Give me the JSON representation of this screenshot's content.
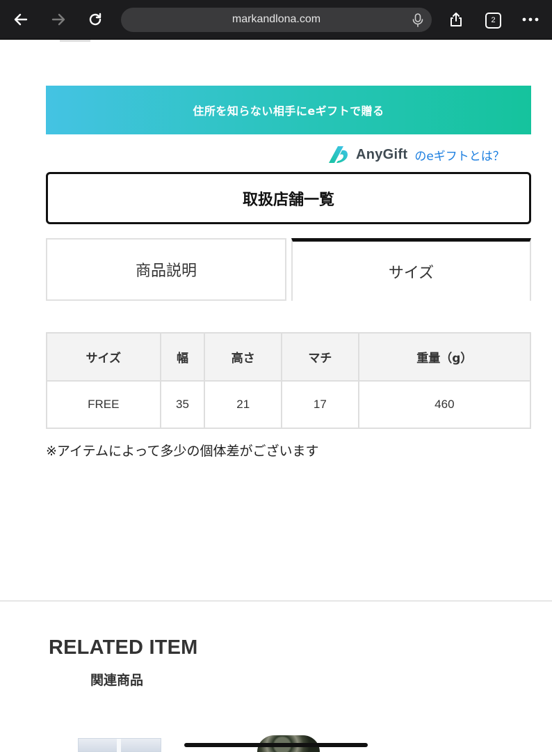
{
  "browser": {
    "url": "markandlona.com",
    "tab_count": "2",
    "icons": {
      "back": "arrow-left-icon",
      "forward": "arrow-right-icon",
      "reload": "reload-icon",
      "mic": "microphone-icon",
      "share": "share-icon",
      "tabs": "tabs-icon",
      "more": "more-dots-icon"
    }
  },
  "egift": {
    "banner_label": "住所を知らない相手にeギフトで贈る",
    "brand": "AnyGift",
    "link_label": "のeギフトとは？",
    "colors": {
      "gradient_start": "#44c3e3",
      "gradient_end": "#15c39d",
      "link": "#1d7fe0"
    }
  },
  "stores_button_label": "取扱店舗一覧",
  "tabs": [
    {
      "label": "商品説明",
      "active": false
    },
    {
      "label": "サイズ",
      "active": true
    }
  ],
  "size_table": {
    "headers": [
      "サイズ",
      "幅",
      "高さ",
      "マチ",
      "重量（g）"
    ],
    "rows": [
      [
        "FREE",
        "35",
        "21",
        "17",
        "460"
      ]
    ]
  },
  "size_note": "※アイテムによって多少の個体差がございます",
  "related": {
    "title": "RELATED ITEM",
    "subtitle": "関連商品"
  }
}
